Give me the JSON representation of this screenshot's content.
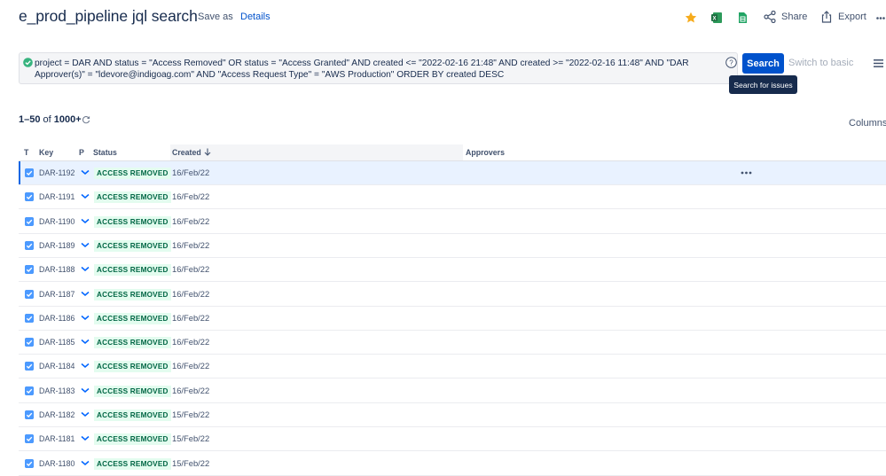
{
  "header": {
    "title": "e_prod_pipeline jql search",
    "save_as": "Save as",
    "details": "Details",
    "share": "Share",
    "export": "Export",
    "star_color": "#f6ab1c"
  },
  "search": {
    "jql": "project = DAR AND status = \"Access Removed\" OR status = \"Access Granted\" AND created <= \"2022-02-16 21:48\" AND created >= \"2022-02-16 11:48\" AND \"DAR Approver(s)\" = \"ldevore@indigoag.com\" AND \"Access Request Type\" = \"AWS Production\" ORDER BY created DESC",
    "search_label": "Search",
    "switch_label": "Switch to basic",
    "tooltip": "Search for issues"
  },
  "results": {
    "range": "1–50",
    "of": "of",
    "total": "1000+",
    "columns_label": "Columns"
  },
  "table": {
    "headers": {
      "t": "T",
      "key": "Key",
      "p": "P",
      "status": "Status",
      "created": "Created",
      "approvers": "Approvers"
    },
    "rows": [
      {
        "key": "DAR-1192",
        "status": "ACCESS REMOVED",
        "created": "16/Feb/22"
      },
      {
        "key": "DAR-1191",
        "status": "ACCESS REMOVED",
        "created": "16/Feb/22"
      },
      {
        "key": "DAR-1190",
        "status": "ACCESS REMOVED",
        "created": "16/Feb/22"
      },
      {
        "key": "DAR-1189",
        "status": "ACCESS REMOVED",
        "created": "16/Feb/22"
      },
      {
        "key": "DAR-1188",
        "status": "ACCESS REMOVED",
        "created": "16/Feb/22"
      },
      {
        "key": "DAR-1187",
        "status": "ACCESS REMOVED",
        "created": "16/Feb/22"
      },
      {
        "key": "DAR-1186",
        "status": "ACCESS REMOVED",
        "created": "16/Feb/22"
      },
      {
        "key": "DAR-1185",
        "status": "ACCESS REMOVED",
        "created": "16/Feb/22"
      },
      {
        "key": "DAR-1184",
        "status": "ACCESS REMOVED",
        "created": "16/Feb/22"
      },
      {
        "key": "DAR-1183",
        "status": "ACCESS REMOVED",
        "created": "16/Feb/22"
      },
      {
        "key": "DAR-1182",
        "status": "ACCESS REMOVED",
        "created": "15/Feb/22"
      },
      {
        "key": "DAR-1181",
        "status": "ACCESS REMOVED",
        "created": "15/Feb/22"
      },
      {
        "key": "DAR-1180",
        "status": "ACCESS REMOVED",
        "created": "15/Feb/22"
      }
    ]
  }
}
